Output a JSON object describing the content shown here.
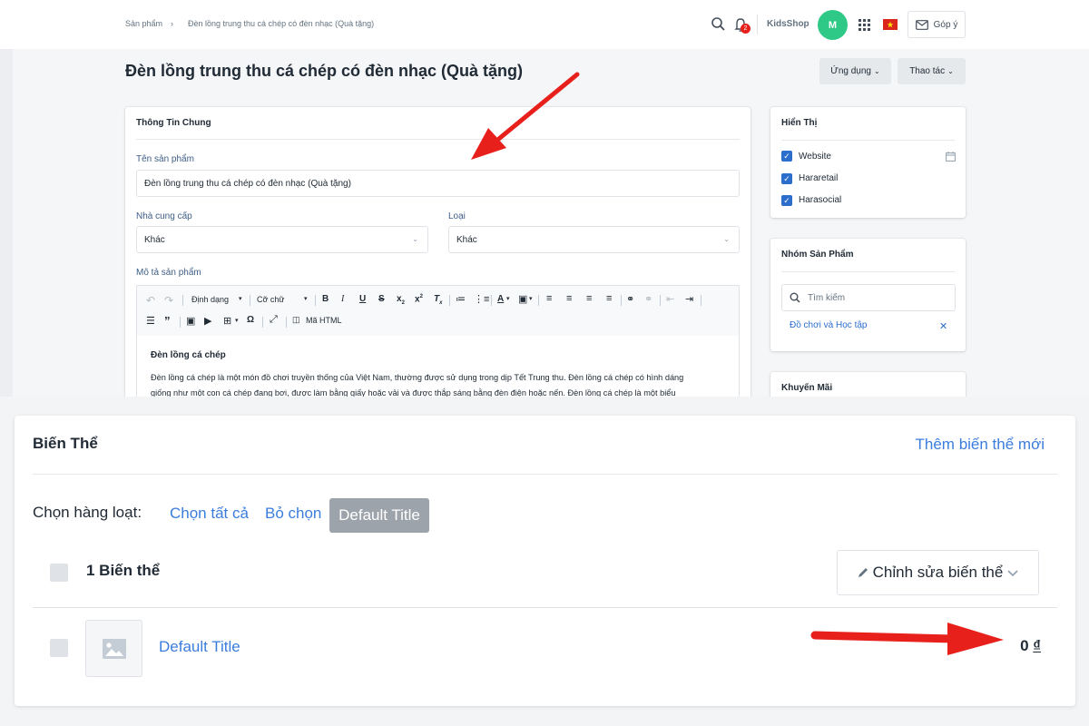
{
  "breadcrumb": {
    "parent": "Sản phẩm",
    "separator": "›",
    "current": "Đèn lồng trung thu cá chép có đèn nhạc (Quà tặng)"
  },
  "topbar": {
    "notification_count": "2",
    "store_name": "KidsShop",
    "avatar_initial": "M",
    "feedback_label": "Góp ý"
  },
  "page": {
    "title": "Đèn lồng trung thu cá chép có đèn nhạc (Quà tặng)",
    "apps_button": "Ứng dụng",
    "actions_button": "Thao tác"
  },
  "general": {
    "title": "Thông Tin Chung",
    "name_label": "Tên sản phẩm",
    "name_value": "Đèn lồng trung thu cá chép có đèn nhạc (Quà tặng)",
    "vendor_label": "Nhà cung cấp",
    "vendor_value": "Khác",
    "type_label": "Loại",
    "type_value": "Khác",
    "desc_label": "Mô tả sản phẩm"
  },
  "editor": {
    "format_label": "Định dạng",
    "size_label": "Cỡ chữ",
    "html_label": "Mã HTML",
    "heading": "Đèn lồng cá chép",
    "paragraph_line1": "Đèn lồng cá chép là một món đồ chơi truyền thống của Việt Nam, thường được sử dụng trong dịp Tết Trung thu. Đèn lồng cá chép có hình dáng",
    "paragraph_line2": "giống như một con cá chép đang bơi, được làm bằng giấy hoặc vải và được thắp sáng bằng đèn điện hoặc nến. Đèn lồng cá chép là một biểu"
  },
  "visibility": {
    "title": "Hiển Thị",
    "channels": [
      "Website",
      "Hararetail",
      "Harasocial"
    ]
  },
  "product_group": {
    "title": "Nhóm Sản Phẩm",
    "search_placeholder": "Tìm kiếm",
    "tag": "Đồ chơi và Học tập"
  },
  "promotion": {
    "title": "Khuyến Mãi"
  },
  "variants": {
    "title": "Biến Thể",
    "add_link": "Thêm biến thể mới",
    "bulk_label": "Chọn hàng loạt:",
    "select_all": "Chọn tất cả",
    "deselect": "Bỏ chọn",
    "default_chip": "Default Title",
    "count_label": "1 Biến thể",
    "edit_button": "Chỉnh sửa biến thể",
    "rows": [
      {
        "name": "Default Title",
        "price": "0",
        "currency": "₫"
      }
    ]
  },
  "colors": {
    "accent": "#3b7ddd",
    "avatar": "#2fc987",
    "checkbox": "#2c6ecb",
    "annotation_arrow": "#e8201b"
  }
}
